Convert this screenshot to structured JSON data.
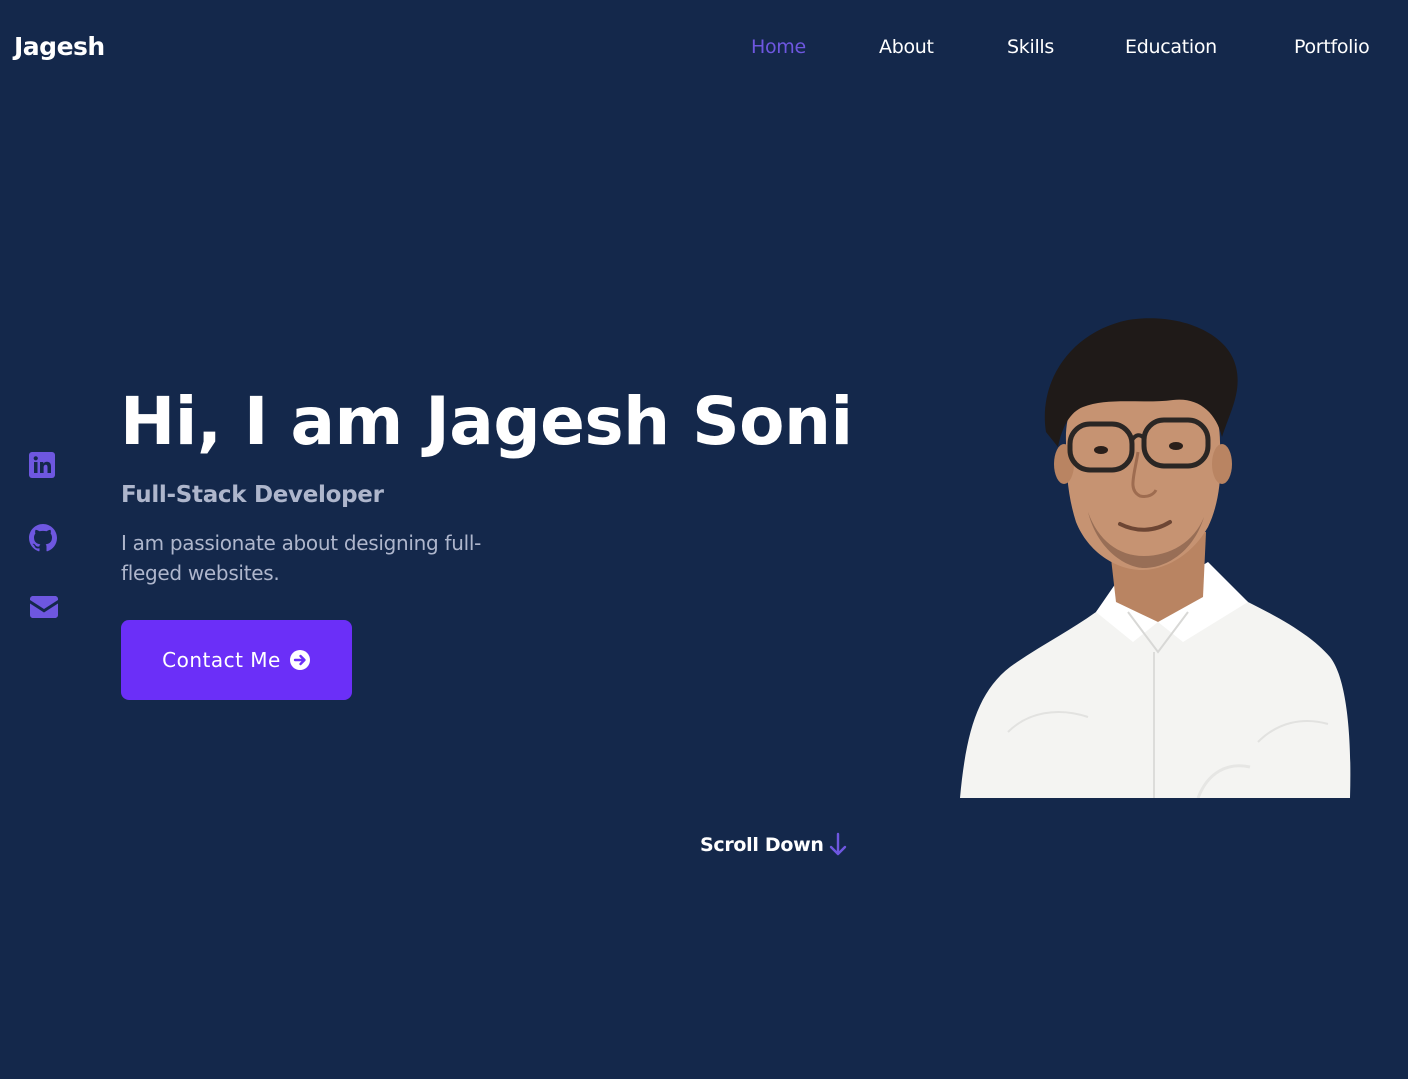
{
  "header": {
    "logo": "Jagesh",
    "nav": [
      {
        "label": "Home",
        "active": true
      },
      {
        "label": "About",
        "active": false
      },
      {
        "label": "Skills",
        "active": false
      },
      {
        "label": "Education",
        "active": false
      },
      {
        "label": "Portfolio",
        "active": false
      }
    ]
  },
  "social": [
    {
      "icon": "linkedin-icon"
    },
    {
      "icon": "github-icon"
    },
    {
      "icon": "mail-icon"
    }
  ],
  "hero": {
    "title": "Hi, I am Jagesh Soni",
    "subtitle": "Full-Stack Developer",
    "description": "I am passionate about designing full-fleged websites.",
    "contact_button": "Contact Me",
    "contact_icon": "arrow-circle-right-icon"
  },
  "scroll": {
    "label": "Scroll Down",
    "icon": "arrow-down-icon"
  },
  "colors": {
    "background": "#14284b",
    "accent": "#6e57e0",
    "button": "#6b2ff8",
    "text_muted": "#aeb6cc"
  }
}
